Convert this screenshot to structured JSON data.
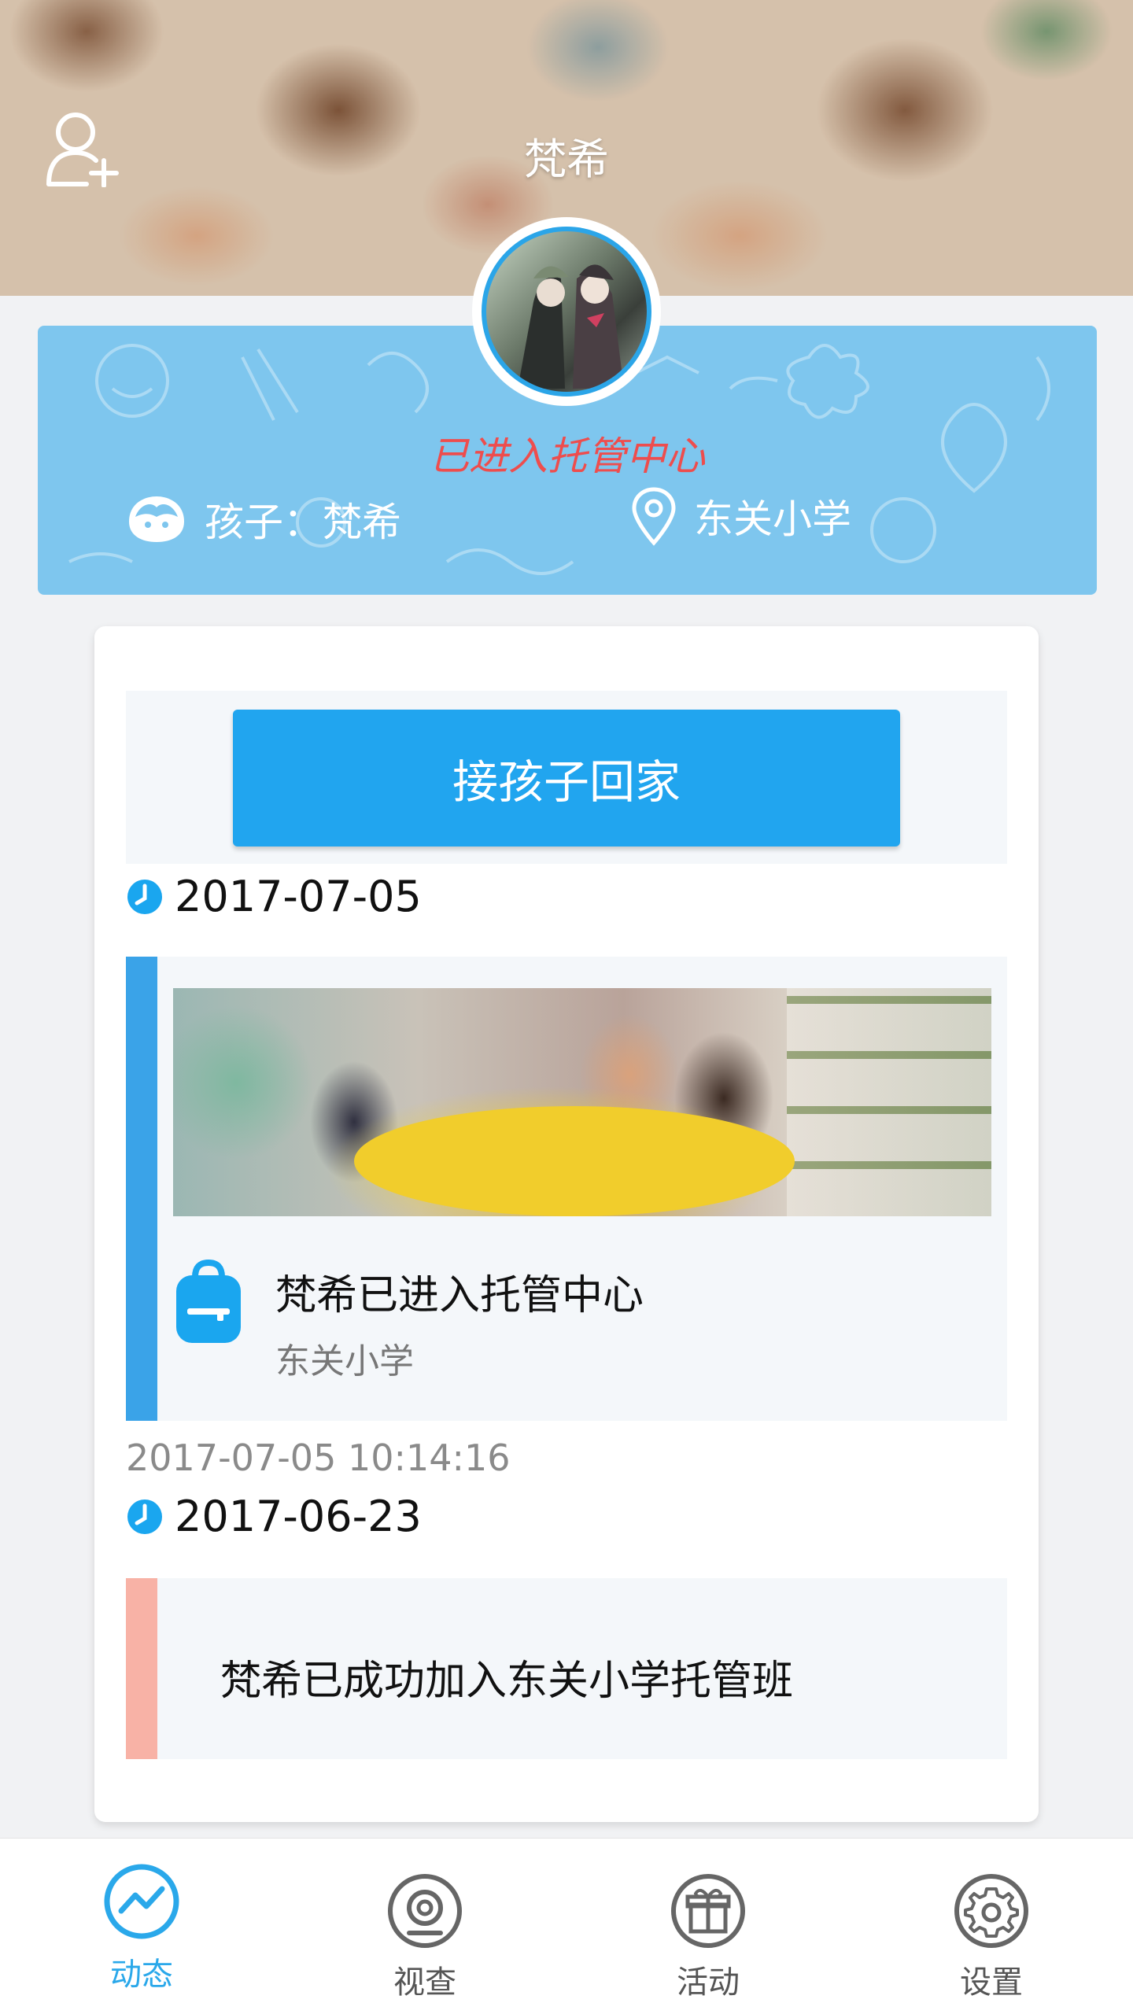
{
  "header": {
    "title": "梵希",
    "add_user_icon": "add-user-icon"
  },
  "profile": {
    "status": "已进入托管中心",
    "child_label": "孩子：梵希",
    "school": "东关小学",
    "status_color": "#ee4d4d",
    "card_color": "#7ec6ee"
  },
  "main": {
    "pickup_label": "接孩子回家",
    "groups": [
      {
        "date": "2017-07-05",
        "event_title": "梵希已进入托管中心",
        "event_sub": "东关小学",
        "event_time": "2017-07-05 10:14:16",
        "bar_color": "#3aa3e8"
      },
      {
        "date": "2017-06-23",
        "event_title": "梵希已成功加入东关小学托管班",
        "bar_color": "#f8b2a6"
      }
    ]
  },
  "nav": {
    "items": [
      {
        "label": "动态",
        "icon": "trend-icon",
        "active": true
      },
      {
        "label": "视查",
        "icon": "camera-icon",
        "active": false
      },
      {
        "label": "活动",
        "icon": "gift-icon",
        "active": false
      },
      {
        "label": "设置",
        "icon": "gear-icon",
        "active": false
      }
    ],
    "active_color": "#2aa8ea"
  }
}
